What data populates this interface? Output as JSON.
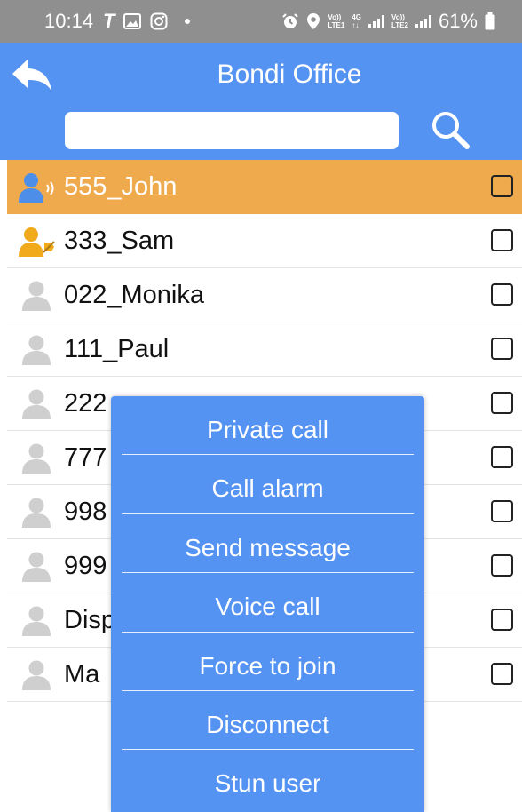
{
  "status_bar": {
    "time": "10:14",
    "carrier_glyph": "T",
    "volte_1": [
      "Vo))",
      "LTE1"
    ],
    "network": [
      "4G",
      "↑↓"
    ],
    "volte_2": [
      "Vo))",
      "LTE2"
    ],
    "battery_percent": "61%"
  },
  "header": {
    "title": "Bondi Office",
    "search_value": ""
  },
  "contacts": [
    {
      "name": "555_John",
      "selected": true,
      "icon": "user-speaking-icon",
      "checked": false
    },
    {
      "name": "333_Sam",
      "selected": false,
      "icon": "user-muted-icon",
      "checked": false
    },
    {
      "name": "022_Monika",
      "selected": false,
      "icon": "user-offline-icon",
      "checked": false
    },
    {
      "name": "111_Paul",
      "selected": false,
      "icon": "user-offline-icon",
      "checked": false
    },
    {
      "name": "222",
      "selected": false,
      "icon": "user-offline-icon",
      "checked": false
    },
    {
      "name": "777",
      "selected": false,
      "icon": "user-offline-icon",
      "checked": false
    },
    {
      "name": "998",
      "selected": false,
      "icon": "user-offline-icon",
      "checked": false
    },
    {
      "name": "999",
      "selected": false,
      "icon": "user-offline-icon",
      "checked": false
    },
    {
      "name": "Disp",
      "selected": false,
      "icon": "user-offline-icon",
      "checked": false
    },
    {
      "name": "Ma",
      "selected": false,
      "icon": "user-offline-icon",
      "checked": false
    }
  ],
  "menu": {
    "items": [
      {
        "label": "Private call"
      },
      {
        "label": "Call alarm"
      },
      {
        "label": "Send message"
      },
      {
        "label": "Voice call"
      },
      {
        "label": "Force to join"
      },
      {
        "label": "Disconnect"
      },
      {
        "label": "Stun user"
      }
    ]
  },
  "colors": {
    "header_blue": "#5593f3",
    "selected_row": "#efaa4e",
    "status_bar": "#8f8f8f",
    "user_active_blue": "#4d8fe8",
    "user_orange": "#f1aa1c",
    "user_gray": "#cfcfcf"
  }
}
